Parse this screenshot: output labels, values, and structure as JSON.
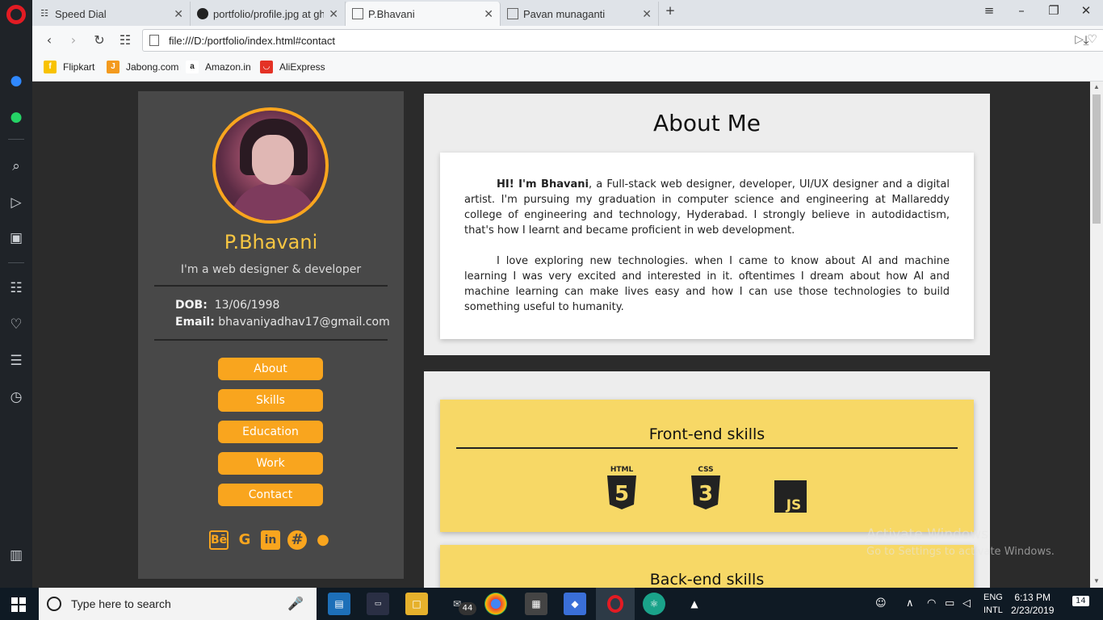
{
  "browser": {
    "tabs": [
      {
        "label": "Speed Dial",
        "icon": "grid-icon",
        "active": false
      },
      {
        "label": "portfolio/profile.jpg at gh-",
        "icon": "github-icon",
        "active": false
      },
      {
        "label": "P.Bhavani",
        "icon": "page-icon",
        "active": true
      },
      {
        "label": "Pavan munaganti",
        "icon": "page-icon",
        "active": false
      }
    ],
    "new_tab_symbol": "+",
    "url": "file:///D:/portfolio/index.html#contact",
    "bookmarks": [
      {
        "label": "Flipkart",
        "icon": "flipkart-icon",
        "color": "#f8c200"
      },
      {
        "label": "Jabong.com",
        "icon": "jabong-icon",
        "color": "#f39a1e"
      },
      {
        "label": "Amazon.in",
        "icon": "amazon-icon",
        "color": "#222222"
      },
      {
        "label": "AliExpress",
        "icon": "aliexpress-icon",
        "color": "#e43225"
      }
    ]
  },
  "profile": {
    "name": "P.Bhavani",
    "tagline": "I'm a web designer & developer",
    "dob_label": "DOB:",
    "dob": "13/06/1998",
    "email_label": "Email:",
    "email": "bhavaniyadhav17@gmail.com",
    "nav": [
      "About",
      "Skills",
      "Education",
      "Work",
      "Contact"
    ],
    "social_icons": [
      "behance-icon",
      "google-icon",
      "linkedin-icon",
      "hashnode-icon",
      "github-icon"
    ]
  },
  "about": {
    "title": "About Me",
    "para1_bold": "HI! I'm Bhavani",
    "para1_rest": ", a Full-stack web designer, developer, UI/UX designer and a digital artist. I'm pursuing my graduation in computer science and engineering at Mallareddy college of engineering and technology, Hyderabad. I strongly believe in autodidactism, that's how I learnt and became proficient in web development.",
    "para2": "I love exploring new technologies. when I came to know about AI and machine learning I was very excited and interested in it. oftentimes I dream about how AI and machine learning can make lives easy and how I can use those technologies to build something useful to humanity."
  },
  "skills": {
    "frontend_title": "Front-end skills",
    "frontend_logos": [
      {
        "label": "HTML",
        "number": "5"
      },
      {
        "label": "CSS",
        "number": "3"
      },
      {
        "label": "JS"
      }
    ],
    "backend_title": "Back-end skills"
  },
  "watermark": {
    "line1": "Activate Windows",
    "line2": "Go to Settings to activate Windows."
  },
  "taskbar": {
    "search_placeholder": "Type here to search",
    "mail_badge": "44",
    "lang_line1": "ENG",
    "lang_line2": "INTL",
    "time": "6:13 PM",
    "date": "2/23/2019",
    "notification_count": "14"
  },
  "colors": {
    "accent": "#f9a51e",
    "name_color": "#f7c642",
    "skill_card": "#f7d866",
    "profile_bg": "#484848"
  }
}
